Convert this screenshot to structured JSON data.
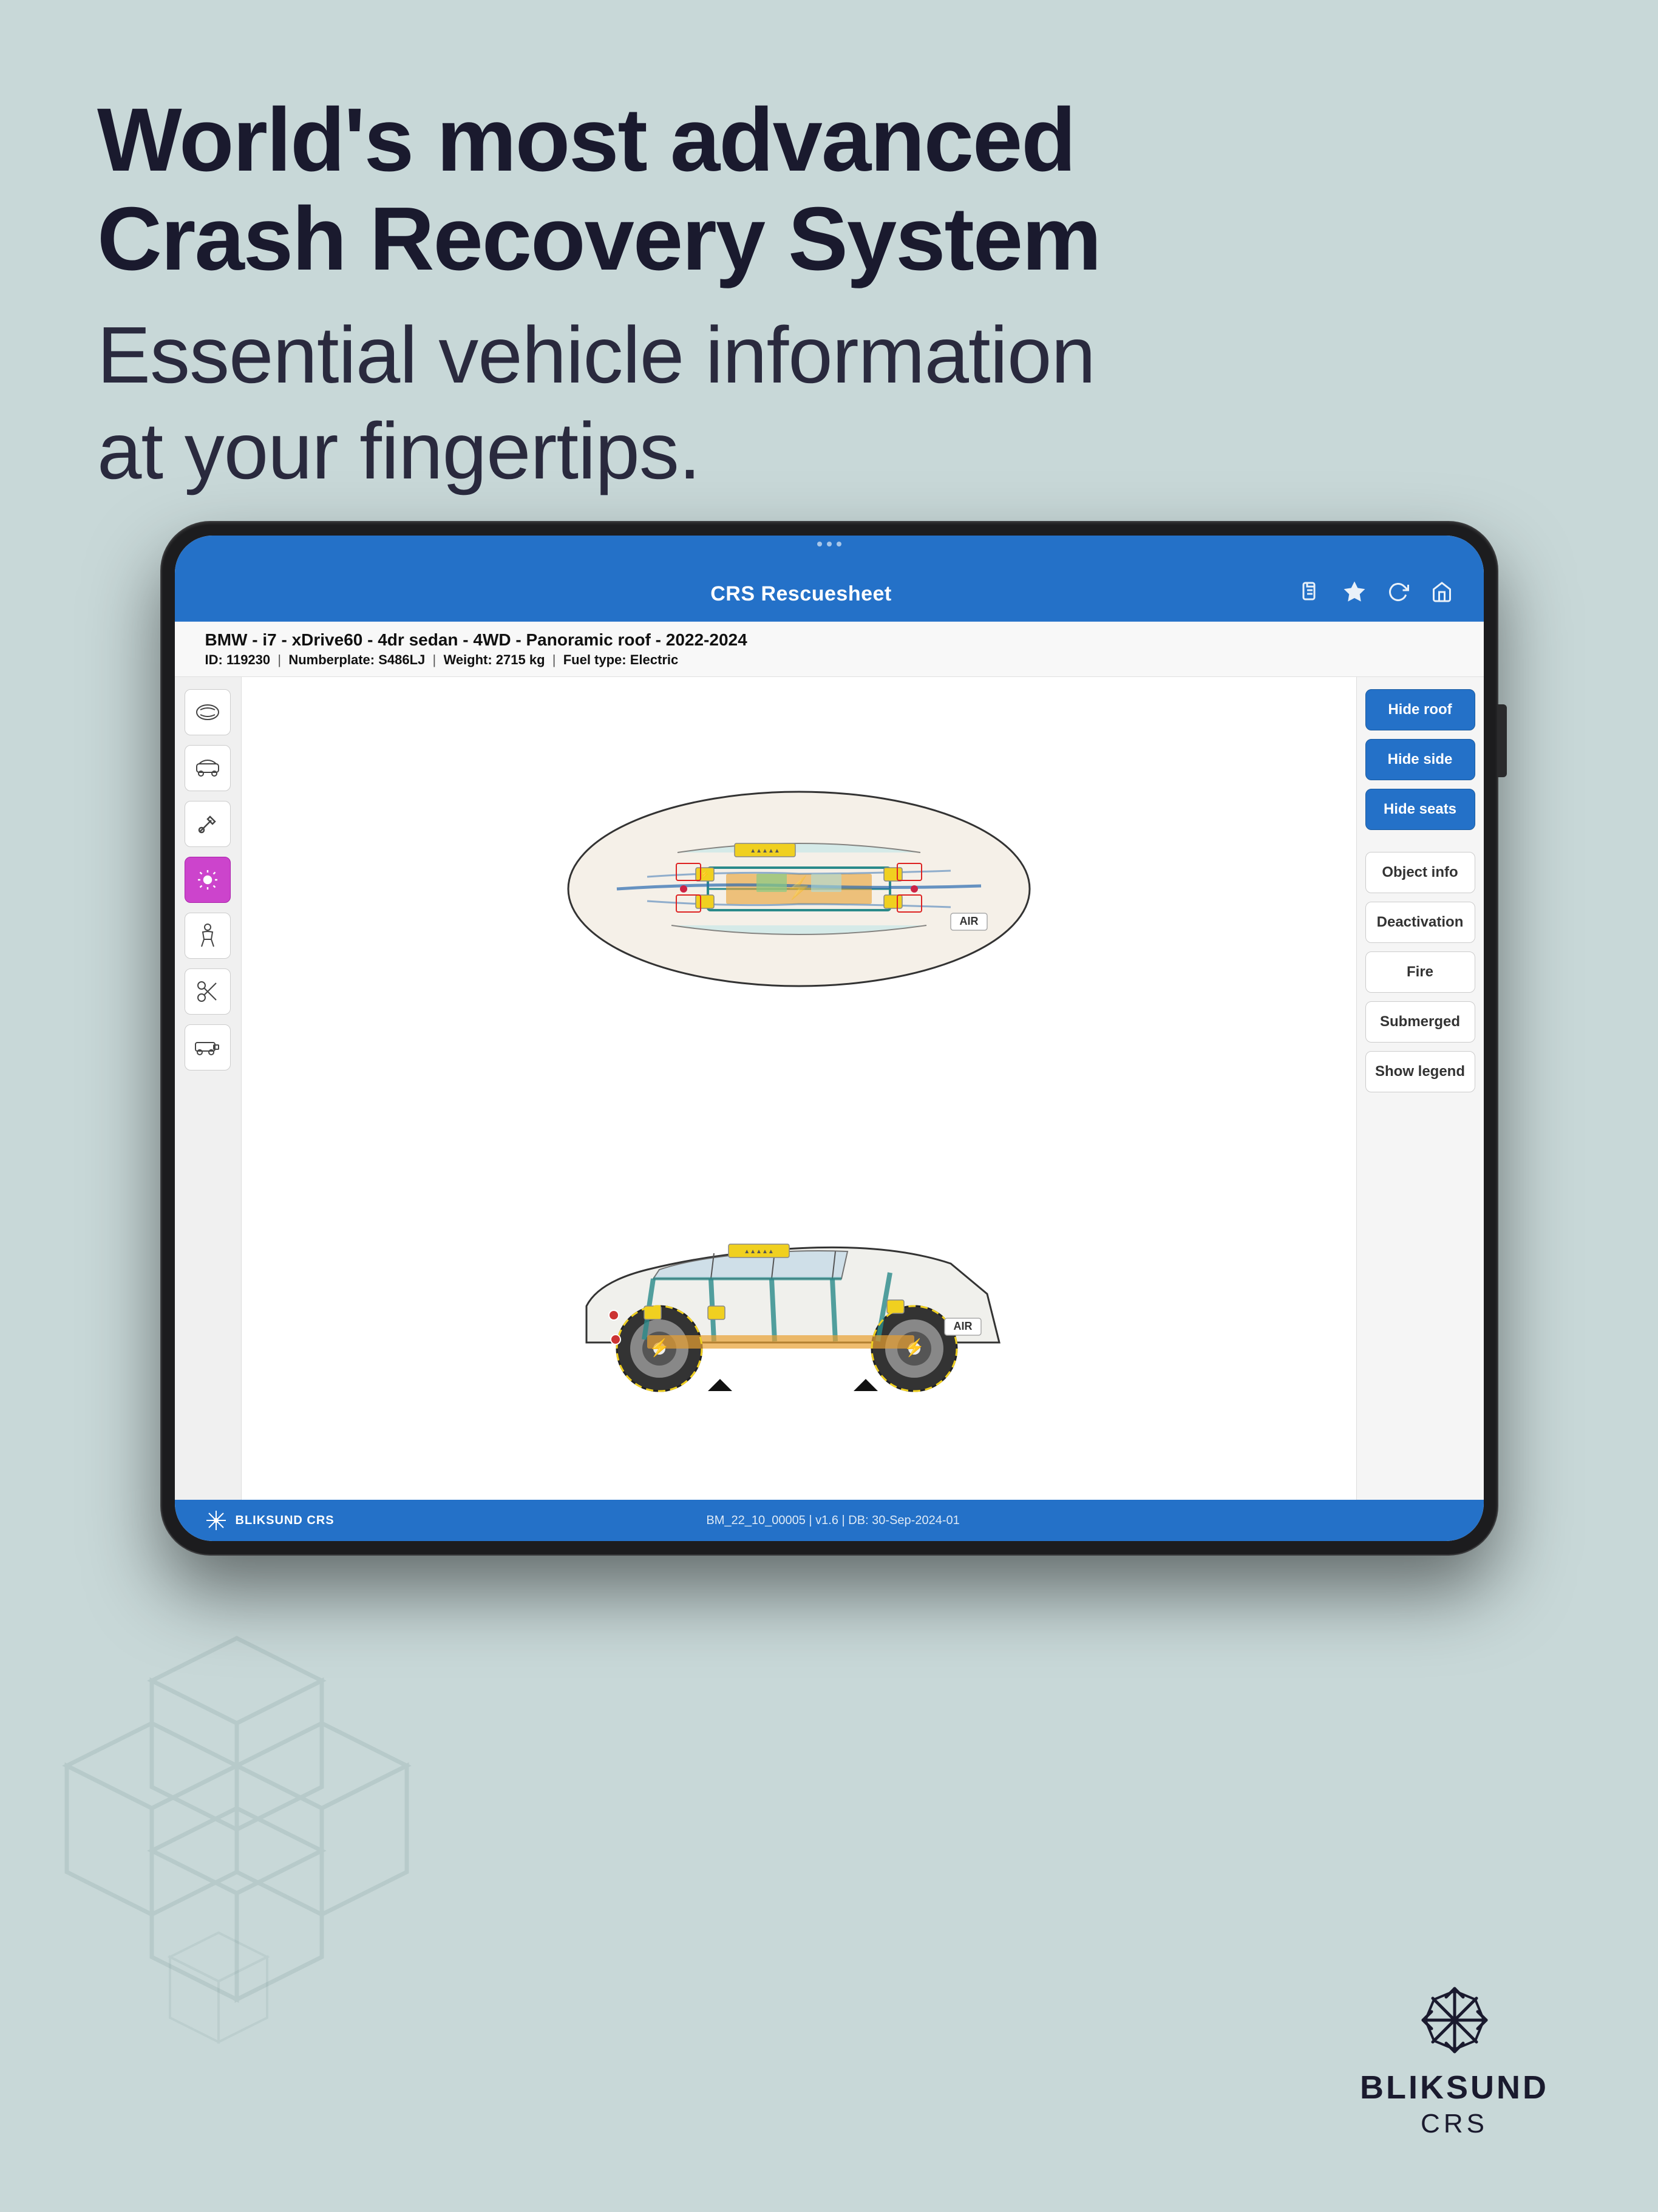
{
  "hero": {
    "title_line1": "World's most advanced",
    "title_line2": "Crash Recovery System",
    "subtitle_line1": "Essential vehicle information",
    "subtitle_line2": "at your fingertips."
  },
  "app": {
    "status_bar_title": "CRS Rescuesheet",
    "vehicle_title": "BMW - i7 - xDrive60 - 4dr sedan - 4WD - Panoramic roof - 2022-2024",
    "vehicle_id": "ID: 119230",
    "vehicle_numberplate": "Numberplate: S486LJ",
    "vehicle_weight": "Weight: 2715 kg",
    "vehicle_fuel": "Fuel type:",
    "vehicle_fuel_value": "Electric",
    "bottom_info": "BM_22_10_00005 | v1.6 | DB: 30-Sep-2024-01"
  },
  "right_buttons": {
    "hide_roof": "Hide roof",
    "hide_side": "Hide side",
    "hide_seats": "Hide seats",
    "object_info": "Object info",
    "deactivation": "Deactivation",
    "fire": "Fire",
    "submerged": "Submerged",
    "show_legend": "Show legend"
  },
  "brand": {
    "name": "BLIKSUND",
    "sub": "CRS"
  },
  "colors": {
    "app_blue": "#2471c8",
    "active_purple": "#cc44cc",
    "bg": "#c8d8d8"
  }
}
